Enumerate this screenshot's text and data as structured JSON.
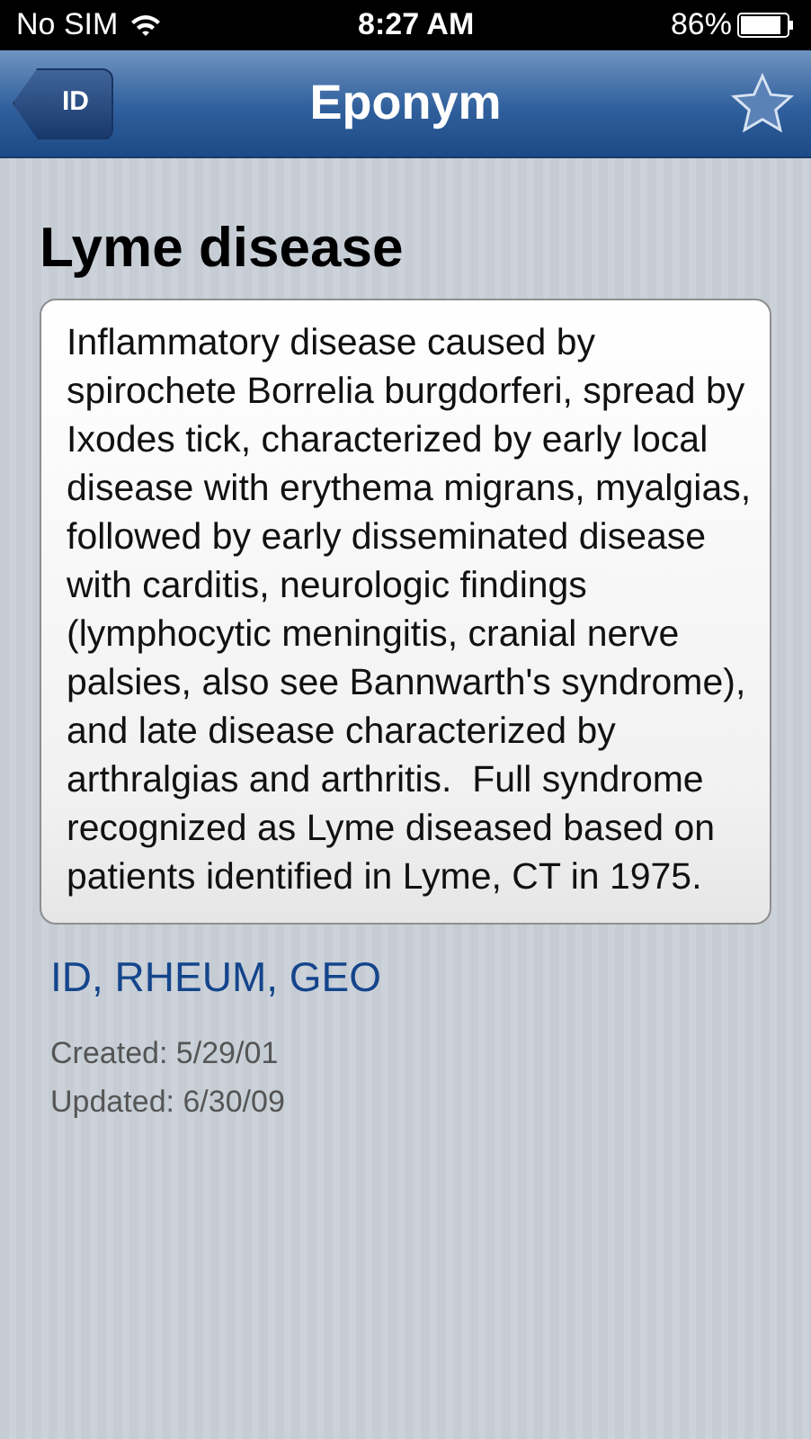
{
  "status_bar": {
    "carrier": "No SIM",
    "time": "8:27 AM",
    "battery": "86%"
  },
  "nav_bar": {
    "back_button": "ID",
    "title": "Eponym"
  },
  "entry": {
    "title": "Lyme disease",
    "description": "Inflammatory disease caused by spirochete Borrelia burgdorferi, spread by Ixodes tick, characterized by early local disease with erythema migrans, myalgias, followed by early disseminated disease with carditis, neurologic findings (lymphocytic meningitis, cranial nerve palsies, also see Bannwarth's syndrome), and late disease characterized by arthralgias and arthritis.  Full syndrome recognized as Lyme diseased based on patients identified in Lyme, CT in 1975.",
    "categories": "ID, RHEUM, GEO",
    "created": "Created: 5/29/01",
    "updated": "Updated: 6/30/09"
  }
}
